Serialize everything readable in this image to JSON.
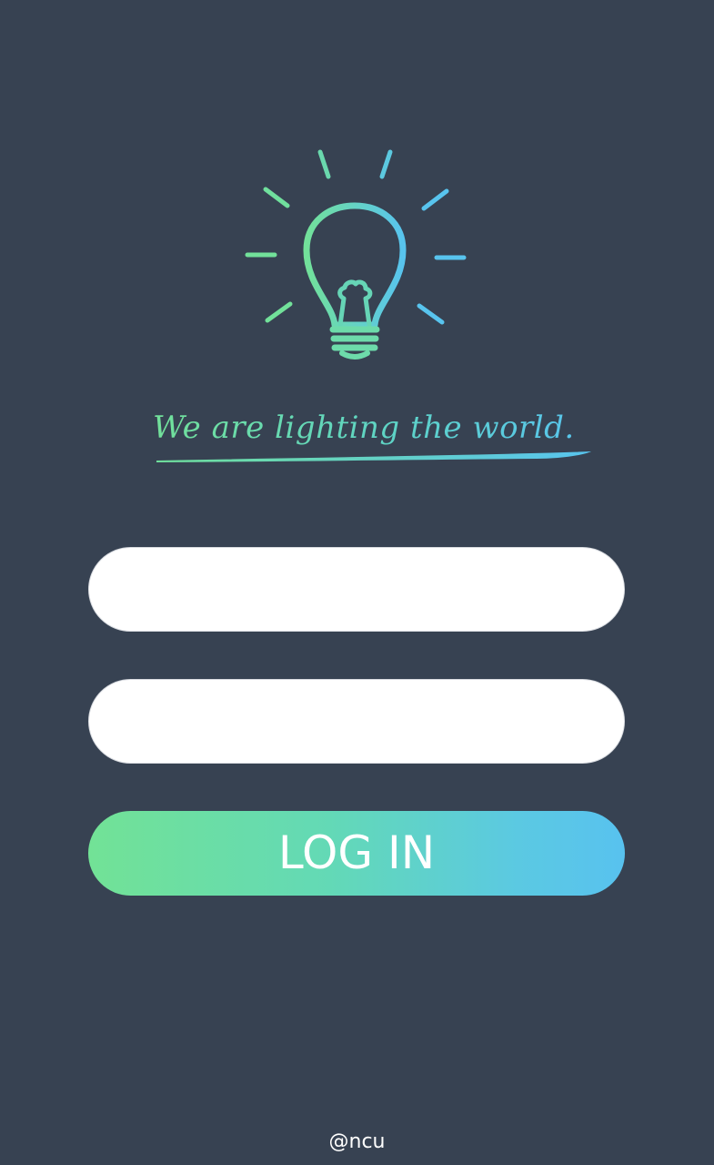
{
  "logo": {
    "icon": "lightbulb-icon",
    "gradient_start": "#72e19a",
    "gradient_end": "#58c4ee"
  },
  "tagline": {
    "text": "We are lighting the world."
  },
  "login_form": {
    "username_value": "",
    "password_value": "",
    "submit_label": "LOG IN"
  },
  "footer": {
    "credit": "@ncu"
  },
  "colors": {
    "background": "#374252",
    "field_background": "#ffffff",
    "button_gradient_start": "#72e296",
    "button_gradient_end": "#58c2ef",
    "button_text": "#ffffff"
  }
}
